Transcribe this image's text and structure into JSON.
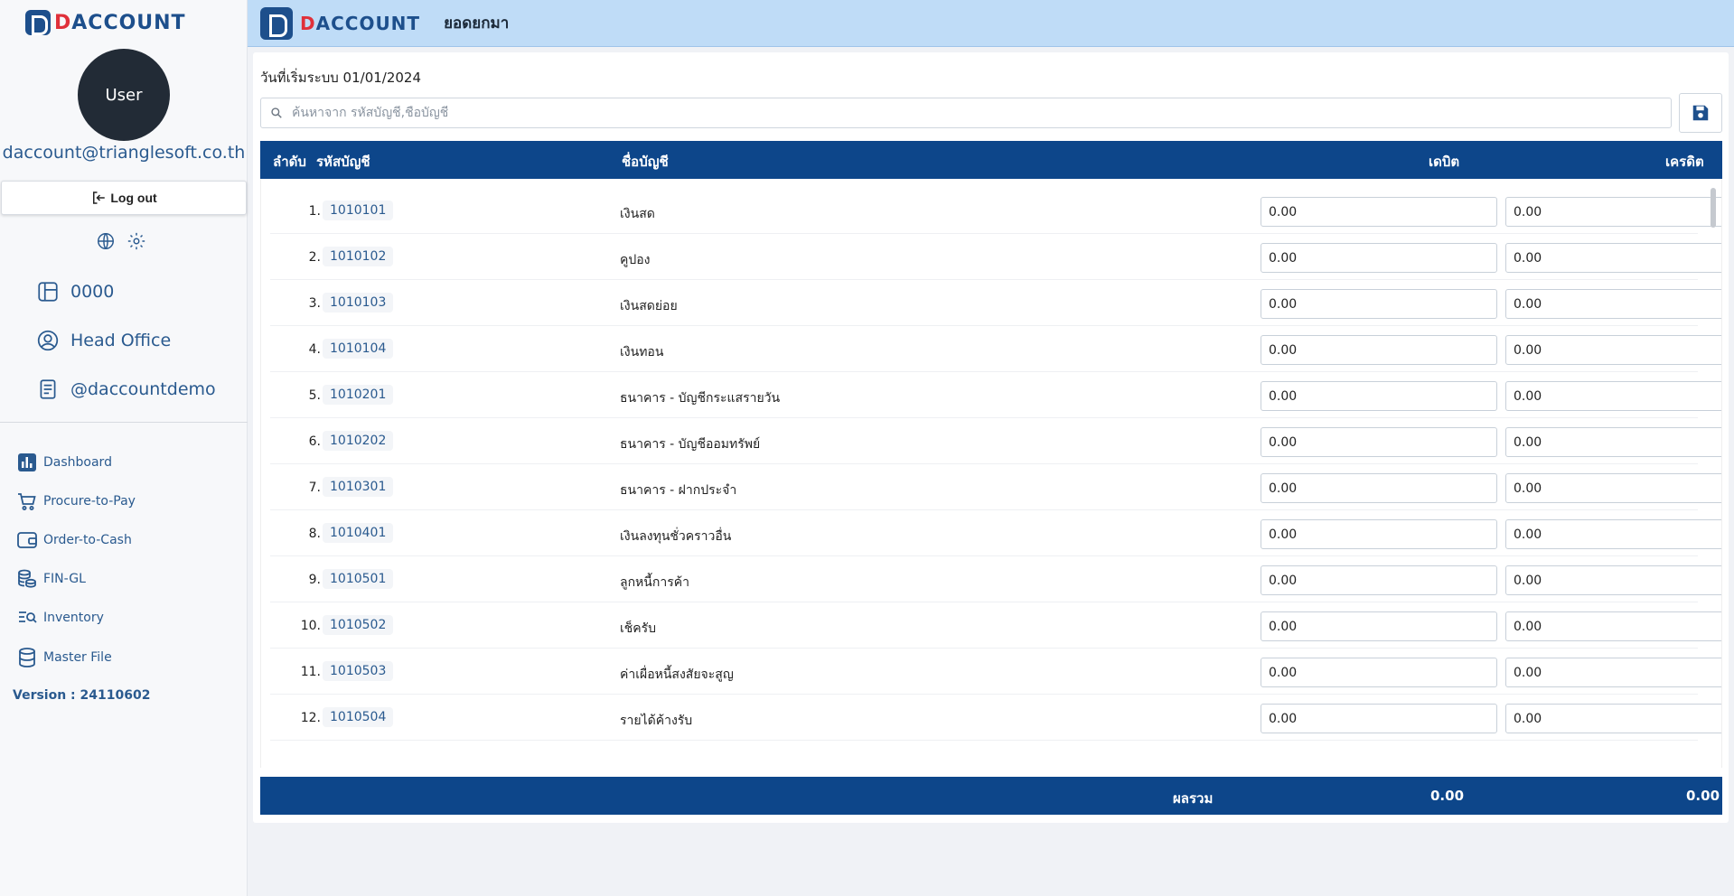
{
  "brand": {
    "d": "D",
    "rest": "ACCOUNT"
  },
  "user": {
    "avatar_label": "User",
    "email": "daccount@trianglesoft.co.th"
  },
  "logout_label": "Log out",
  "info": [
    {
      "icon": "layout-icon",
      "label": "0000"
    },
    {
      "icon": "user-circle-icon",
      "label": "Head Office"
    },
    {
      "icon": "document-icon",
      "label": "@daccountdemo"
    }
  ],
  "nav": [
    {
      "icon": "bar-chart-icon",
      "label": "Dashboard"
    },
    {
      "icon": "cart-icon",
      "label": "Procure-to-Pay"
    },
    {
      "icon": "wallet-icon",
      "label": "Order-to-Cash"
    },
    {
      "icon": "coins-icon",
      "label": "FIN-GL"
    },
    {
      "icon": "list-search-icon",
      "label": "Inventory"
    },
    {
      "icon": "database-icon",
      "label": "Master File"
    }
  ],
  "version": "Version : 24110602",
  "page_title": "ยอดยกมา",
  "start_date": "วันที่เริ่มระบบ 01/01/2024",
  "search": {
    "placeholder": "ค้นหาจาก รหัสบัญชี,ชื่อบัญชี",
    "value": ""
  },
  "table": {
    "headers": {
      "index": "ลำดับ",
      "code": "รหัสบัญชี",
      "name": "ชื่อบัญชี",
      "debit": "เดบิต",
      "credit": "เครดิต"
    },
    "rows": [
      {
        "index": "1.",
        "code": "1010101",
        "name": "เงินสด",
        "debit": "0.00",
        "credit": "0.00"
      },
      {
        "index": "2.",
        "code": "1010102",
        "name": "คูปอง",
        "debit": "0.00",
        "credit": "0.00"
      },
      {
        "index": "3.",
        "code": "1010103",
        "name": "เงินสดย่อย",
        "debit": "0.00",
        "credit": "0.00"
      },
      {
        "index": "4.",
        "code": "1010104",
        "name": "เงินทอน",
        "debit": "0.00",
        "credit": "0.00"
      },
      {
        "index": "5.",
        "code": "1010201",
        "name": "ธนาคาร - บัญชีกระแสรายวัน",
        "debit": "0.00",
        "credit": "0.00"
      },
      {
        "index": "6.",
        "code": "1010202",
        "name": "ธนาคาร - บัญชีออมทรัพย์",
        "debit": "0.00",
        "credit": "0.00"
      },
      {
        "index": "7.",
        "code": "1010301",
        "name": "ธนาคาร - ฝากประจำ",
        "debit": "0.00",
        "credit": "0.00"
      },
      {
        "index": "8.",
        "code": "1010401",
        "name": "เงินลงทุนชั่วคราวอื่น",
        "debit": "0.00",
        "credit": "0.00"
      },
      {
        "index": "9.",
        "code": "1010501",
        "name": "ลูกหนี้การค้า",
        "debit": "0.00",
        "credit": "0.00"
      },
      {
        "index": "10.",
        "code": "1010502",
        "name": "เช็ครับ",
        "debit": "0.00",
        "credit": "0.00"
      },
      {
        "index": "11.",
        "code": "1010503",
        "name": "ค่าเผื่อหนี้สงสัยจะสูญ",
        "debit": "0.00",
        "credit": "0.00"
      },
      {
        "index": "12.",
        "code": "1010504",
        "name": "รายได้ค้างรับ",
        "debit": "0.00",
        "credit": "0.00"
      }
    ],
    "footer": {
      "label": "ผลรวม",
      "debit_total": "0.00",
      "credit_total": "0.00"
    }
  },
  "colors": {
    "primary": "#0d468a",
    "topbar": "#bfdcf7",
    "accent_red": "#e0303a",
    "link": "#2a5a8f"
  }
}
